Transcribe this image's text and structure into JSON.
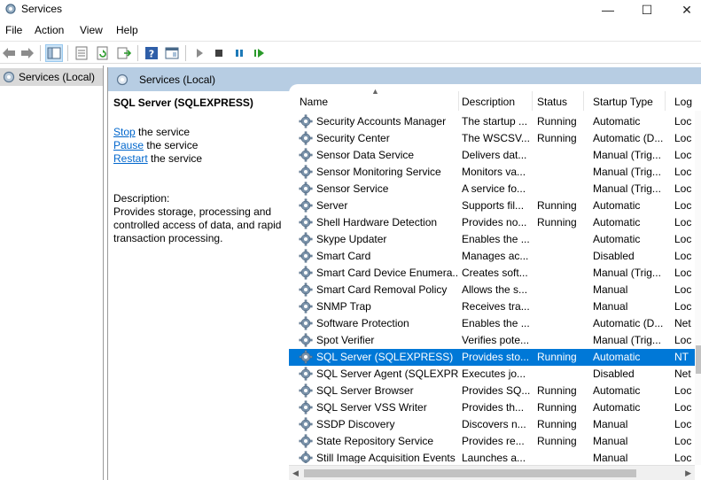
{
  "window": {
    "title": "Services",
    "minimize_glyph": "—",
    "maximize_glyph": "☐",
    "close_glyph": "✕"
  },
  "menu": [
    "File",
    "Action",
    "View",
    "Help"
  ],
  "toolbar": {
    "icons": [
      "back-arrow-icon",
      "forward-arrow-icon",
      "show-hide-console-tree-icon",
      "properties-icon",
      "refresh-icon",
      "export-list-icon",
      "help-icon",
      "view-icon",
      "start-service-icon",
      "stop-service-icon",
      "pause-service-icon",
      "resume-service-icon"
    ]
  },
  "tree": {
    "item_label": "Services (Local)"
  },
  "header": {
    "title": "Services (Local)"
  },
  "extended": {
    "title": "SQL Server (SQLEXPRESS)",
    "stop_link": "Stop",
    "stop_suffix": " the service",
    "pause_link": "Pause",
    "pause_suffix": " the service",
    "restart_link": "Restart",
    "restart_suffix": " the service",
    "description_label": "Description:",
    "description_text": "Provides storage, processing and controlled access of data, and rapid transaction processing."
  },
  "columns": {
    "name": "Name",
    "description": "Description",
    "status": "Status",
    "startup": "Startup Type",
    "log": "Log"
  },
  "services": [
    {
      "name": "Security Accounts Manager",
      "description": "The startup ...",
      "status": "Running",
      "startup": "Automatic",
      "log": "Loc"
    },
    {
      "name": "Security Center",
      "description": "The WSCSV...",
      "status": "Running",
      "startup": "Automatic (D...",
      "log": "Loc"
    },
    {
      "name": "Sensor Data Service",
      "description": "Delivers dat...",
      "status": "",
      "startup": "Manual (Trig...",
      "log": "Loc"
    },
    {
      "name": "Sensor Monitoring Service",
      "description": "Monitors va...",
      "status": "",
      "startup": "Manual (Trig...",
      "log": "Loc"
    },
    {
      "name": "Sensor Service",
      "description": "A service fo...",
      "status": "",
      "startup": "Manual (Trig...",
      "log": "Loc"
    },
    {
      "name": "Server",
      "description": "Supports fil...",
      "status": "Running",
      "startup": "Automatic",
      "log": "Loc"
    },
    {
      "name": "Shell Hardware Detection",
      "description": "Provides no...",
      "status": "Running",
      "startup": "Automatic",
      "log": "Loc"
    },
    {
      "name": "Skype Updater",
      "description": "Enables the ...",
      "status": "",
      "startup": "Automatic",
      "log": "Loc"
    },
    {
      "name": "Smart Card",
      "description": "Manages ac...",
      "status": "",
      "startup": "Disabled",
      "log": "Loc"
    },
    {
      "name": "Smart Card Device Enumera...",
      "description": "Creates soft...",
      "status": "",
      "startup": "Manual (Trig...",
      "log": "Loc"
    },
    {
      "name": "Smart Card Removal Policy",
      "description": "Allows the s...",
      "status": "",
      "startup": "Manual",
      "log": "Loc"
    },
    {
      "name": "SNMP Trap",
      "description": "Receives tra...",
      "status": "",
      "startup": "Manual",
      "log": "Loc"
    },
    {
      "name": "Software Protection",
      "description": "Enables the ...",
      "status": "",
      "startup": "Automatic (D...",
      "log": "Net"
    },
    {
      "name": "Spot Verifier",
      "description": "Verifies pote...",
      "status": "",
      "startup": "Manual (Trig...",
      "log": "Loc"
    },
    {
      "name": "SQL Server (SQLEXPRESS)",
      "description": "Provides sto...",
      "status": "Running",
      "startup": "Automatic",
      "log": "NT",
      "selected": true
    },
    {
      "name": "SQL Server Agent (SQLEXPR...",
      "description": "Executes jo...",
      "status": "",
      "startup": "Disabled",
      "log": "Net"
    },
    {
      "name": "SQL Server Browser",
      "description": "Provides SQ...",
      "status": "Running",
      "startup": "Automatic",
      "log": "Loc"
    },
    {
      "name": "SQL Server VSS Writer",
      "description": "Provides th...",
      "status": "Running",
      "startup": "Automatic",
      "log": "Loc"
    },
    {
      "name": "SSDP Discovery",
      "description": "Discovers n...",
      "status": "Running",
      "startup": "Manual",
      "log": "Loc"
    },
    {
      "name": "State Repository Service",
      "description": "Provides re...",
      "status": "Running",
      "startup": "Manual",
      "log": "Loc"
    },
    {
      "name": "Still Image Acquisition Events",
      "description": "Launches a...",
      "status": "",
      "startup": "Manual",
      "log": "Loc"
    }
  ],
  "colors": {
    "selection": "#0078d7",
    "header_band": "#b7cde3",
    "link": "#0066cc"
  }
}
